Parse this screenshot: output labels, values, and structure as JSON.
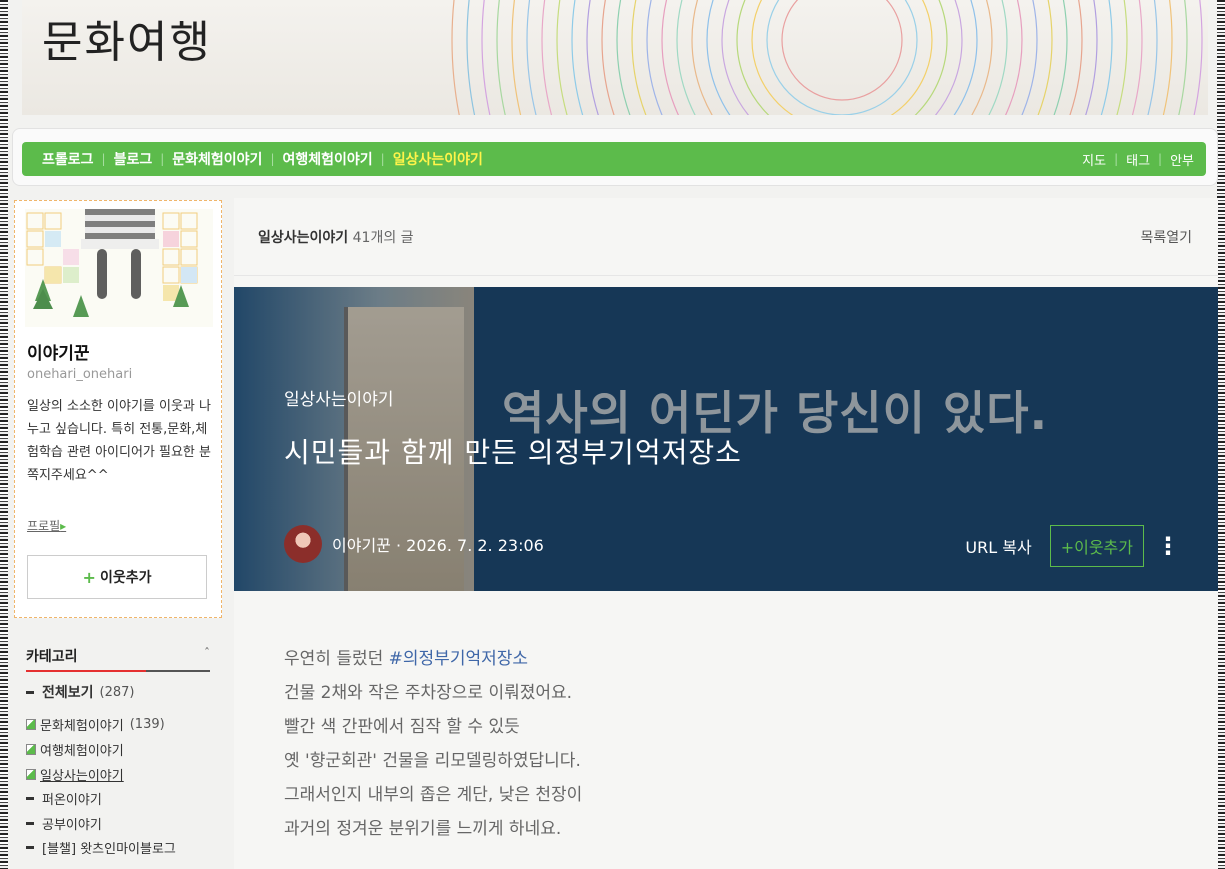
{
  "header": {
    "title": "문화여행"
  },
  "nav": {
    "left": [
      {
        "label": "프롤로그",
        "active": false
      },
      {
        "label": "블로그",
        "active": false
      },
      {
        "label": "문화체험이야기",
        "active": false
      },
      {
        "label": "여행체험이야기",
        "active": false
      },
      {
        "label": "일상사는이야기",
        "active": true
      }
    ],
    "right": [
      "지도",
      "태그",
      "안부"
    ],
    "separator": "|"
  },
  "profile": {
    "name": "이야기꾼",
    "id": "onehari_onehari",
    "desc": "일상의 소소한 이야기를 이웃과 나누고 싶습니다. 특히 전통,문화,체험학습 관련 아이디어가 필요한 분 쪽지주세요^^",
    "link": "프로필",
    "link_dot": "▸",
    "add_neighbor": "이웃추가",
    "add_plus": "+"
  },
  "category": {
    "title": "카테고리",
    "toggle": "ˆ",
    "all": {
      "label": "전체보기",
      "count": "(287)"
    },
    "items": [
      {
        "label": "문화체험이야기",
        "count": "(139)",
        "icon": "page"
      },
      {
        "label": "여행체험이야기",
        "count": "",
        "icon": "page"
      },
      {
        "label": "일상사는이야기",
        "count": "",
        "icon": "page",
        "current": true
      },
      {
        "label": "퍼온이야기",
        "count": "",
        "icon": "dash"
      },
      {
        "label": "공부이야기",
        "count": "",
        "icon": "dash"
      },
      {
        "label": "[블챌] 왓츠인마이블로그",
        "count": "",
        "icon": "dash"
      }
    ]
  },
  "list": {
    "category": "일상사는이야기",
    "count": "41개의 글",
    "open": "목록열기"
  },
  "post": {
    "sign_text": "역사의 어딘가 당신이 있다.",
    "category": "일상사는이야기",
    "title": "시민들과 함께 만든 의정부기억저장소",
    "author_line": "이야기꾼 · 2026. 7. 2. 23:06",
    "url_copy": "URL 복사",
    "add_neighbor": "+이웃추가",
    "more": "⋮",
    "body": {
      "line1_prefix": "우연히 들렀던 ",
      "line1_tag": "#의정부기억저장소",
      "line2": "건물 2채와 작은 주차장으로 이뤄졌어요.",
      "line3": "빨간 색 간판에서 짐작 할 수 있듯",
      "line4": "옛 '향군회관' 건물을 리모델링하였답니다.",
      "line5": "그래서인지 내부의 좁은 계단, 낮은 천장이",
      "line6": "과거의 정겨운 분위기를 느끼게 하네요."
    }
  },
  "colors": {
    "accent": "#5cbb4b",
    "active_nav": "#fff44a",
    "tag": "#3f67a8"
  }
}
